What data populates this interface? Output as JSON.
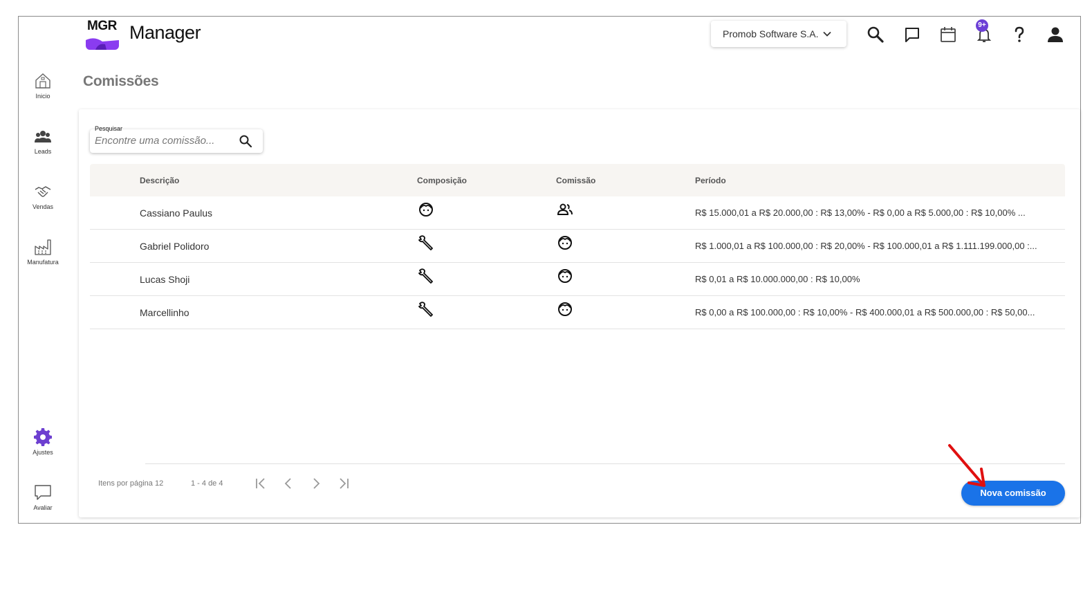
{
  "header": {
    "logo_text": "MGR",
    "app_title": "Manager",
    "company": "Promob Software S.A.",
    "notification_badge": "9+"
  },
  "sidebar": {
    "items": [
      {
        "label": "Inicio",
        "icon": "home-icon"
      },
      {
        "label": "Leads",
        "icon": "people-icon"
      },
      {
        "label": "Vendas",
        "icon": "handshake-icon"
      },
      {
        "label": "Manufatura",
        "icon": "factory-icon"
      }
    ],
    "bottom_items": [
      {
        "label": "Ajustes",
        "icon": "gear-icon"
      },
      {
        "label": "Avaliar",
        "icon": "feedback-icon"
      }
    ]
  },
  "page": {
    "title": "Comissões"
  },
  "search": {
    "label": "Pesquisar",
    "placeholder": "Encontre uma comissão..."
  },
  "table": {
    "columns": [
      "Descrição",
      "Composição",
      "Comissão",
      "Período"
    ],
    "rows": [
      {
        "descricao": "Cassiano Paulus",
        "composicao_icon": "face-icon",
        "comissao_icon": "group-icon",
        "periodo": "R$ 15.000,01 a R$ 20.000,00 : R$ 13,00% - R$ 0,00 a R$ 5.000,00 : R$ 10,00% ..."
      },
      {
        "descricao": "Gabriel Polidoro",
        "composicao_icon": "wrench-icon",
        "comissao_icon": "face-icon",
        "periodo": "R$ 1.000,01 a R$ 100.000,00 : R$ 20,00% - R$ 100.000,01 a R$ 1.111.199.000,00 :..."
      },
      {
        "descricao": "Lucas Shoji",
        "composicao_icon": "wrench-icon",
        "comissao_icon": "face-icon",
        "periodo": "R$ 0,01 a R$ 10.000.000,00 : R$ 10,00%"
      },
      {
        "descricao": "Marcellinho",
        "composicao_icon": "wrench-icon",
        "comissao_icon": "face-icon",
        "periodo": "R$ 0,00 a R$ 100.000,00 : R$ 10,00% - R$ 400.000,01 a R$ 500.000,00 : R$ 50,00..."
      }
    ]
  },
  "pager": {
    "items_per_page": "Itens por página 12",
    "range": "1 - 4 de 4"
  },
  "actions": {
    "new_label": "Nova comissão"
  },
  "colors": {
    "accent": "#1a73e8",
    "brand": "#8a3cf0",
    "arrow": "#e01010"
  }
}
